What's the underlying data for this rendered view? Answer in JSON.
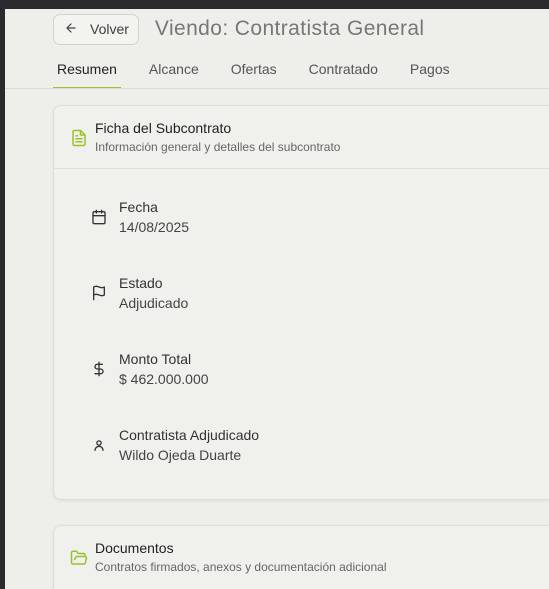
{
  "header": {
    "back_label": "Volver",
    "title": "Viendo: Contratista General"
  },
  "tabs": [
    {
      "label": "Resumen",
      "active": true
    },
    {
      "label": "Alcance",
      "active": false
    },
    {
      "label": "Ofertas",
      "active": false
    },
    {
      "label": "Contratado",
      "active": false
    },
    {
      "label": "Pagos",
      "active": false
    }
  ],
  "ficha": {
    "title": "Ficha del Subcontrato",
    "subtitle": "Información general y detalles del subcontrato",
    "fields": [
      {
        "icon": "calendar-icon",
        "label": "Fecha",
        "value": "14/08/2025"
      },
      {
        "icon": "flag-icon",
        "label": "Estado",
        "value": "Adjudicado"
      },
      {
        "icon": "dollar-icon",
        "label": "Monto Total",
        "value": "$ 462.000.000"
      },
      {
        "icon": "user-icon",
        "label": "Contratista Adjudicado",
        "value": "Wildo Ojeda Duarte"
      }
    ]
  },
  "documentos": {
    "title": "Documentos",
    "subtitle": "Contratos firmados, anexos y documentación adicional"
  },
  "colors": {
    "accent": "#9ac22a",
    "background": "#eeeeea",
    "card": "#f0f0ed"
  }
}
